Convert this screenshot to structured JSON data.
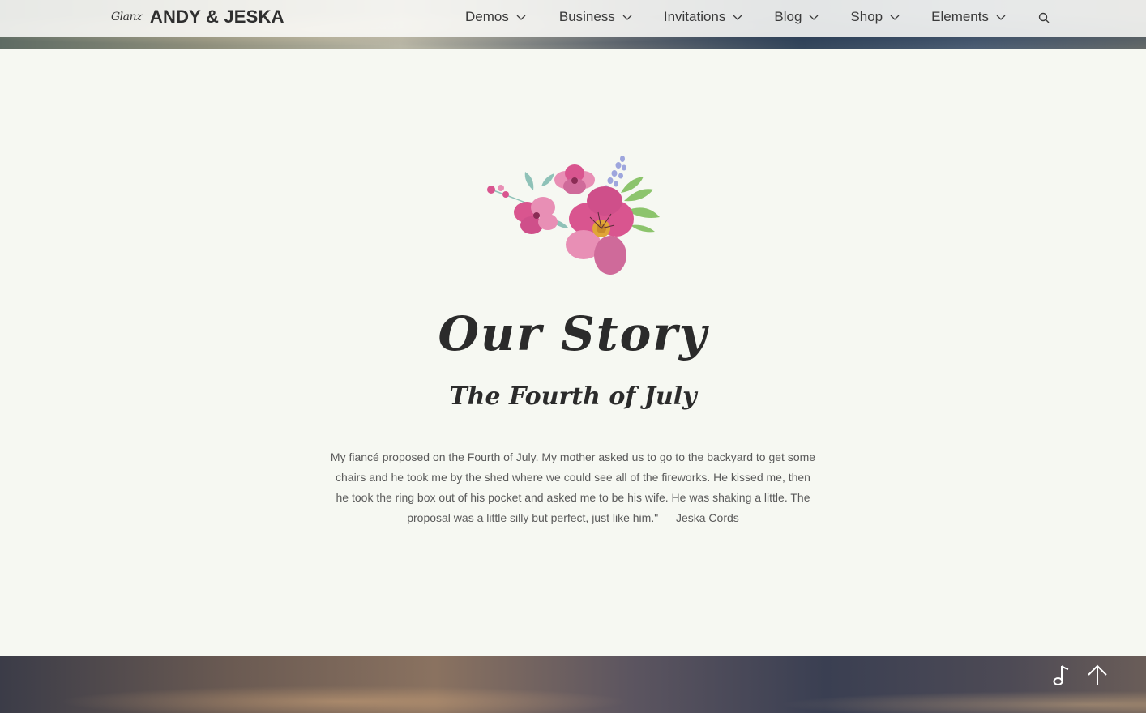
{
  "header": {
    "brand_mark": "Glanz",
    "brand_name": "ANDY & JESKA",
    "nav": [
      {
        "label": "Demos",
        "icon": "chevron-down-icon"
      },
      {
        "label": "Business",
        "icon": "chevron-down-icon"
      },
      {
        "label": "Invitations",
        "icon": "chevron-down-icon"
      },
      {
        "label": "Blog",
        "icon": "chevron-down-icon"
      },
      {
        "label": "Shop",
        "icon": "chevron-down-icon"
      },
      {
        "label": "Elements",
        "icon": "chevron-down-icon"
      }
    ],
    "search_icon": "search-icon"
  },
  "story": {
    "title": "Our Story",
    "subtitle": "The Fourth of July",
    "text": "My fiancé proposed on the Fourth of July. My mother asked us to go to the backyard to get some chairs and he took me by the shed where we could see all of the fireworks. He kissed me, then he took the ring box out of his pocket and asked me to be his wife. He was shaking a little. The proposal was a little silly but perfect, just like him.\" — Jeska Cords",
    "decoration_icon": "floral-bouquet-icon"
  },
  "floating_controls": {
    "music_icon": "music-note-icon",
    "top_icon": "arrow-up-icon"
  },
  "colors": {
    "background": "#f6f8f2",
    "text": "#5a5a5a",
    "heading": "#2b2b2b",
    "flower_pink": "#d9558f",
    "flower_light_pink": "#e88fb5",
    "leaf_green": "#8cc46c",
    "lavender": "#9ea6dd"
  }
}
